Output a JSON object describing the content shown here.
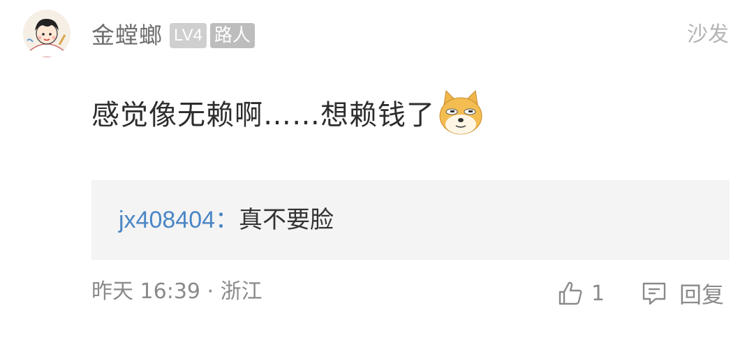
{
  "comment": {
    "user": {
      "name": "金螳螂",
      "level": "LV4",
      "role": "路人"
    },
    "sofa_label": "沙发",
    "text": "感觉像无赖啊……想赖钱了",
    "emoji": "doge-icon",
    "reply": {
      "user": "jx408404",
      "colon": "：",
      "text": "真不要脸"
    },
    "meta": "昨天 16:39 · 浙江",
    "like_count": "1",
    "reply_label": "回复"
  },
  "colors": {
    "reply_user": "#4a86c5",
    "badge": "#cfcfcf",
    "meta": "#8a8a8a"
  }
}
